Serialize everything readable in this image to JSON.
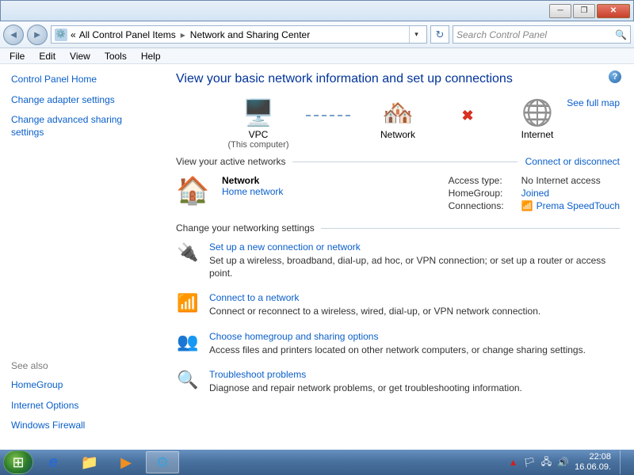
{
  "window": {
    "minimize": "─",
    "maximize": "❐",
    "close": "✕"
  },
  "nav": {
    "back": "◄",
    "forward": "►",
    "bc_chevrons": "«",
    "bc_item1": "All Control Panel Items",
    "bc_item2": "Network and Sharing Center",
    "bc_sep": "▸",
    "bc_dropdown": "▾",
    "refresh": "↻",
    "search_placeholder": "Search Control Panel",
    "search_icon": "🔍"
  },
  "menu": {
    "file": "File",
    "edit": "Edit",
    "view": "View",
    "tools": "Tools",
    "help": "Help"
  },
  "sidebar": {
    "home": "Control Panel Home",
    "adapter": "Change adapter settings",
    "advanced": "Change advanced sharing settings",
    "see_also": "See also",
    "homegroup": "HomeGroup",
    "inet_opts": "Internet Options",
    "firewall": "Windows Firewall"
  },
  "content": {
    "help": "?",
    "title": "View your basic network information and set up connections",
    "full_map": "See full map",
    "map": {
      "node1": "VPC",
      "node1_sub": "(This computer)",
      "node2": "Network",
      "node3": "Internet",
      "x": "✖"
    },
    "active_hdr": "View your active networks",
    "connect_link": "Connect or disconnect",
    "net_name": "Network",
    "net_type": "Home network",
    "details": {
      "access_lbl": "Access type:",
      "access_val": "No Internet access",
      "hg_lbl": "HomeGroup:",
      "hg_val": "Joined",
      "conn_lbl": "Connections:",
      "conn_icon": "📶",
      "conn_val": "Prema SpeedTouch"
    },
    "change_hdr": "Change your networking settings",
    "actions": [
      {
        "title": "Set up a new connection or network",
        "desc": "Set up a wireless, broadband, dial-up, ad hoc, or VPN connection; or set up a router or access point."
      },
      {
        "title": "Connect to a network",
        "desc": "Connect or reconnect to a wireless, wired, dial-up, or VPN network connection."
      },
      {
        "title": "Choose homegroup and sharing options",
        "desc": "Access files and printers located on other network computers, or change sharing settings."
      },
      {
        "title": "Troubleshoot problems",
        "desc": "Diagnose and repair network problems, or get troubleshooting information."
      }
    ]
  },
  "taskbar": {
    "start": "⊞",
    "ie": "e",
    "explorer": "📁",
    "wmp": "▶",
    "control": "⚙",
    "tray": {
      "av": "▲",
      "flag": "🏳",
      "net": "🖧",
      "vol": "🔊",
      "time": "22:08",
      "date": "16.06.09."
    }
  }
}
